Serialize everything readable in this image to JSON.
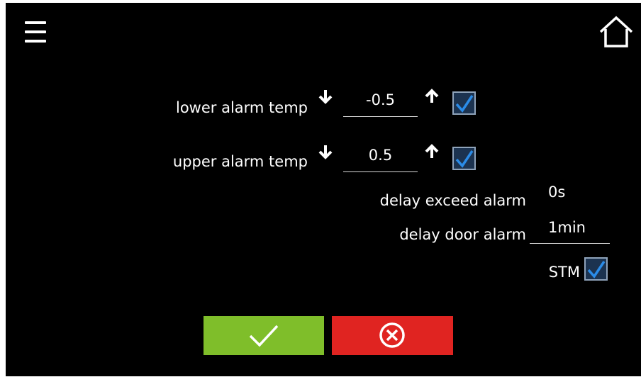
{
  "header": {
    "menu_icon": "hamburger-menu-icon",
    "home_icon": "home-icon"
  },
  "alarm_settings": {
    "lower_alarm": {
      "label": "lower alarm temp",
      "value": "-0.5",
      "enabled": true,
      "decrease_icon": "arrow-down-icon",
      "increase_icon": "arrow-up-icon"
    },
    "upper_alarm": {
      "label": "upper alarm temp",
      "value": "0.5",
      "enabled": true,
      "decrease_icon": "arrow-down-icon",
      "increase_icon": "arrow-up-icon"
    },
    "delay_exceed": {
      "label": "delay exceed alarm",
      "value": "0s"
    },
    "delay_door": {
      "label": "delay door alarm",
      "value": "1min"
    },
    "stm": {
      "label": "STM",
      "enabled": true
    }
  },
  "actions": {
    "confirm_icon": "checkmark-icon",
    "cancel_icon": "circle-x-icon"
  },
  "colors": {
    "background": "#000000",
    "confirm_button": "#7fbe2a",
    "cancel_button": "#e02421",
    "checkbox_check": "#2b8ce8",
    "checkbox_fill": "#1c3350"
  }
}
